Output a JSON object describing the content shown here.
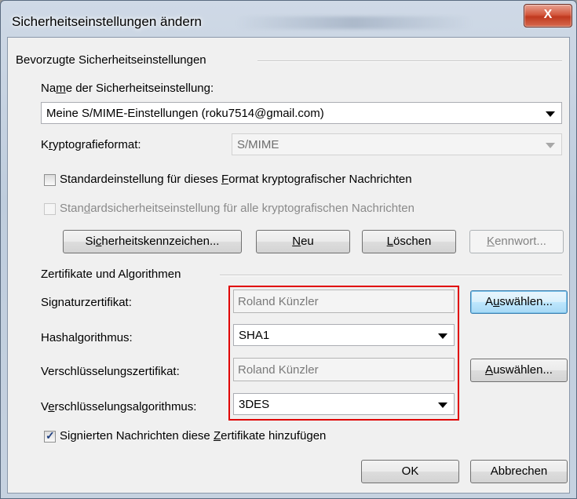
{
  "window": {
    "title": "Sicherheitseinstellungen ändern",
    "close_label": "X"
  },
  "preferred": {
    "group_label": "Bevorzugte Sicherheitseinstellungen",
    "name_label_pre": "Na",
    "name_label_u": "m",
    "name_label_post": "e der Sicherheitseinstellung:",
    "name_value": "Meine S/MIME-Einstellungen (roku7514@gmail.com)",
    "format_label_pre": "K",
    "format_label_u": "r",
    "format_label_post": "yptografieformat:",
    "format_value": "S/MIME",
    "default_format_pre": "Standardeinstellung für dieses ",
    "default_format_u": "F",
    "default_format_post": "ormat kryptografischer Nachrichten",
    "default_all_pre": "Stan",
    "default_all_u": "d",
    "default_all_post": "ardsicherheitseinstellung für alle kryptografischen Nachrichten",
    "btn_labels_pre": "Si",
    "btn_labels_u": "c",
    "btn_labels_post": "herheitskennzeichen...",
    "btn_new_u": "N",
    "btn_new_post": "eu",
    "btn_delete_u": "L",
    "btn_delete_post": "öschen",
    "btn_password_u": "K",
    "btn_password_post": "ennwort..."
  },
  "certs": {
    "group_label": "Zertifikate und Algorithmen",
    "sign_label": "Signaturzertifikat:",
    "sign_value": "Roland Künzler",
    "sign_choose_pre": "A",
    "sign_choose_u": "u",
    "sign_choose_post": "swählen...",
    "hash_label": "Hashalgorithmus:",
    "hash_value": "SHA1",
    "enc_label": "Verschlüsselungszertifikat:",
    "enc_value": "Roland Künzler",
    "enc_choose_u": "A",
    "enc_choose_post": "uswählen...",
    "encalg_label_pre": "V",
    "encalg_label_u": "e",
    "encalg_label_post": "rschlüsselungsalgorithmus:",
    "encalg_value": "3DES",
    "add_certs_pre": "Signierten Nachrichten diese ",
    "add_certs_u": "Z",
    "add_certs_post": "ertifikate hinzufügen"
  },
  "footer": {
    "ok_label": "OK",
    "cancel_label": "Abbrechen"
  },
  "colors": {
    "highlight_border": "#e00000",
    "close_button": "#c0391f"
  }
}
